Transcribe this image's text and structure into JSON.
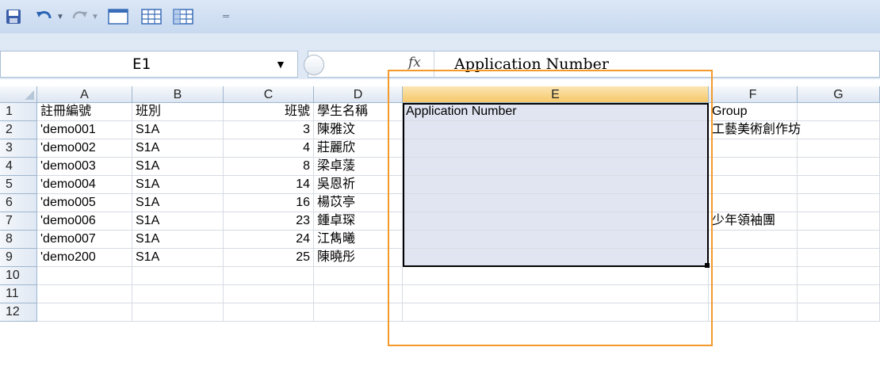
{
  "toolbar": {
    "items": [
      "save-icon",
      "undo-icon",
      "undo-dropdown-icon",
      "redo-icon",
      "redo-dropdown-icon",
      "table-icon",
      "grid-icon",
      "grid2-icon",
      "customize-dropdown-icon"
    ]
  },
  "formula_bar": {
    "name_box": "E1",
    "fx_label": "fx",
    "value": "Application Number"
  },
  "columns": [
    "A",
    "B",
    "C",
    "D",
    "E",
    "F",
    "G"
  ],
  "selected_column": "E",
  "rows": [
    {
      "num": "1",
      "A": "註冊編號",
      "B": "班別",
      "C": "班號",
      "D": "學生名稱",
      "E": "Application Number",
      "F": "Group",
      "G": ""
    },
    {
      "num": "2",
      "A": "'demo001",
      "B": "S1A",
      "C": "3",
      "D": "陳雅汶",
      "E": "",
      "F": "工藝美術創作坊",
      "G": ""
    },
    {
      "num": "3",
      "A": "'demo002",
      "B": "S1A",
      "C": "4",
      "D": "莊麗欣",
      "E": "",
      "F": "",
      "G": ""
    },
    {
      "num": "4",
      "A": "'demo003",
      "B": "S1A",
      "C": "8",
      "D": "梁卓蔆",
      "E": "",
      "F": "",
      "G": ""
    },
    {
      "num": "5",
      "A": "'demo004",
      "B": "S1A",
      "C": "14",
      "D": "吳恩祈",
      "E": "",
      "F": "",
      "G": ""
    },
    {
      "num": "6",
      "A": "'demo005",
      "B": "S1A",
      "C": "16",
      "D": "楊苡亭",
      "E": "",
      "F": "",
      "G": ""
    },
    {
      "num": "7",
      "A": "'demo006",
      "B": "S1A",
      "C": "23",
      "D": "鍾卓琛",
      "E": "",
      "F": "少年領袖團",
      "G": ""
    },
    {
      "num": "8",
      "A": "'demo007",
      "B": "S1A",
      "C": "24",
      "D": "江雋曦",
      "E": "",
      "F": "",
      "G": ""
    },
    {
      "num": "9",
      "A": "'demo200",
      "B": "S1A",
      "C": "25",
      "D": "陳曉彤",
      "E": "",
      "F": "",
      "G": ""
    },
    {
      "num": "10",
      "A": "",
      "B": "",
      "C": "",
      "D": "",
      "E": "",
      "F": "",
      "G": ""
    },
    {
      "num": "11",
      "A": "",
      "B": "",
      "C": "",
      "D": "",
      "E": "",
      "F": "",
      "G": ""
    },
    {
      "num": "12",
      "A": "",
      "B": "",
      "C": "",
      "D": "",
      "E": "",
      "F": "",
      "G": ""
    }
  ],
  "colors": {
    "selection_border": "#000000",
    "highlight_box": "#f39a2b",
    "selection_fill": "#e1e5f2"
  }
}
